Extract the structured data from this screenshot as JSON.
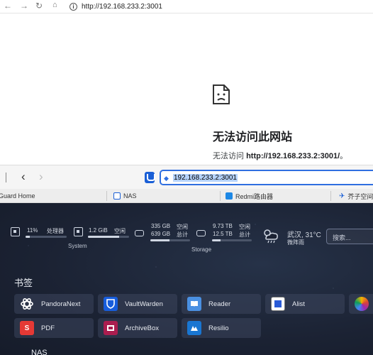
{
  "top_browser": {
    "url": "http://192.168.233.2:3001",
    "error_title": "无法访问此网站",
    "error_prefix": "无法访问 ",
    "error_url": "http://192.168.233.2:3001/",
    "error_suffix": "。"
  },
  "second_browser": {
    "url": "192.168.233.2:3001",
    "bookmarks": [
      {
        "label": "Guard Home"
      },
      {
        "label": "NAS"
      },
      {
        "label": "Redmi路由器"
      },
      {
        "label": "芥子空间 H"
      }
    ]
  },
  "widgets": {
    "cpu_percent_text": "11%",
    "cpu_label": "处理器",
    "cpu_fraction": 0.11,
    "mem_value": "1.2 GiB",
    "mem_label": "空闲",
    "mem_fraction": 0.75,
    "system_label": "System",
    "disk1_free": "335 GB",
    "disk1_total": "639 GB",
    "disk1_free_label": "空闲",
    "disk1_total_label": "总计",
    "disk2_free": "9.73 TB",
    "disk2_total": "12.5 TB",
    "disk2_free_label": "空闲",
    "disk2_total_label": "总计",
    "storage_label": "Storage",
    "weather_city": "武汉, 31°C",
    "weather_desc": "微阵雨",
    "search_placeholder": "搜索..."
  },
  "bookmarks_section": {
    "title": "书签",
    "items": [
      {
        "label": "PandoraNext"
      },
      {
        "label": "VaultWarden"
      },
      {
        "label": "Reader"
      },
      {
        "label": "Alist"
      },
      {
        "label": "PDF"
      },
      {
        "label": "ArchiveBox"
      },
      {
        "label": "Resilio"
      }
    ]
  },
  "next_section": "NAS",
  "colors": {
    "accent": "#2f6fe0",
    "dash_bg": "#1b2233"
  }
}
